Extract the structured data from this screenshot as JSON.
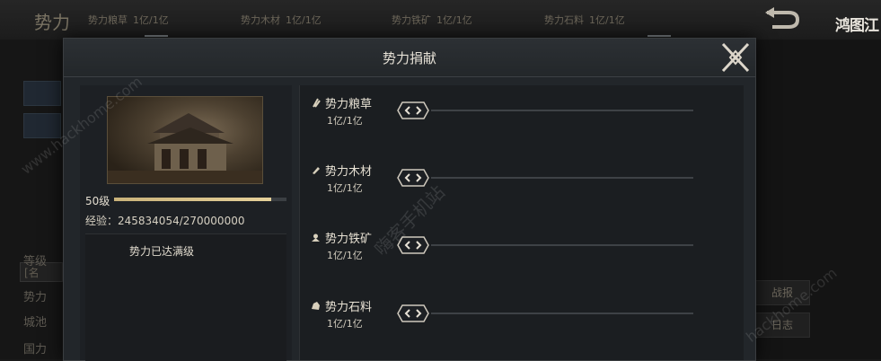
{
  "background": {
    "title": "势力",
    "resources": [
      {
        "name": "势力粮草",
        "value": "1亿/1亿"
      },
      {
        "name": "势力木材",
        "value": "1亿/1亿"
      },
      {
        "name": "势力铁矿",
        "value": "1亿/1亿"
      },
      {
        "name": "势力石料",
        "value": "1亿/1亿"
      }
    ],
    "left_labels": [
      "等级",
      "势力",
      "城池",
      "国力"
    ],
    "left_mini": "[名",
    "right_buttons": [
      "战报",
      "日志"
    ],
    "logo_text": "鸿图江"
  },
  "modal": {
    "title": "势力捐献",
    "close_icon": "close-x-icon"
  },
  "info": {
    "level": "50级",
    "level_progress": 0.91,
    "exp_text": "经验：245834054/270000000",
    "status": "势力已达满级"
  },
  "donations": [
    {
      "name": "势力粮草",
      "value": "1亿/1亿",
      "icon": "grain-icon"
    },
    {
      "name": "势力木材",
      "value": "1亿/1亿",
      "icon": "wood-icon"
    },
    {
      "name": "势力铁矿",
      "value": "1亿/1亿",
      "icon": "iron-icon"
    },
    {
      "name": "势力石料",
      "value": "1亿/1亿",
      "icon": "stone-icon"
    }
  ],
  "watermarks": [
    "www.hackhome.com",
    "嗨客手机站",
    "hackhome.com"
  ],
  "colors": {
    "accent": "#e6d19a",
    "panel": "#22262a"
  }
}
